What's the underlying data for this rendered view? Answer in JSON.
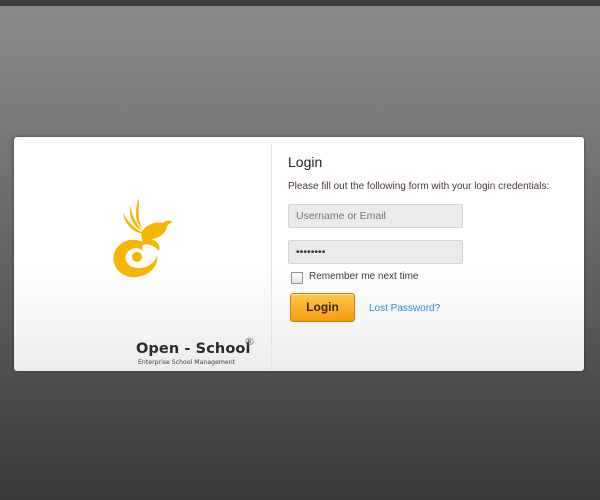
{
  "brand": {
    "name": "Open - School",
    "registered_mark": "®",
    "tagline": "Enterprise School Management",
    "logo_icon": "bird-logo-icon",
    "logo_color": "#f7b500"
  },
  "form": {
    "title": "Login",
    "subtitle": "Please fill out the following form with your login credentials:",
    "username_placeholder": "Username or Email",
    "password_value": "••••••••",
    "remember_label": "Remember me next time",
    "remember_checked": false,
    "login_button": "Login",
    "lost_password_link": "Lost Password?"
  },
  "colors": {
    "accent_button": "#fbb430",
    "link": "#2a8fd1"
  }
}
